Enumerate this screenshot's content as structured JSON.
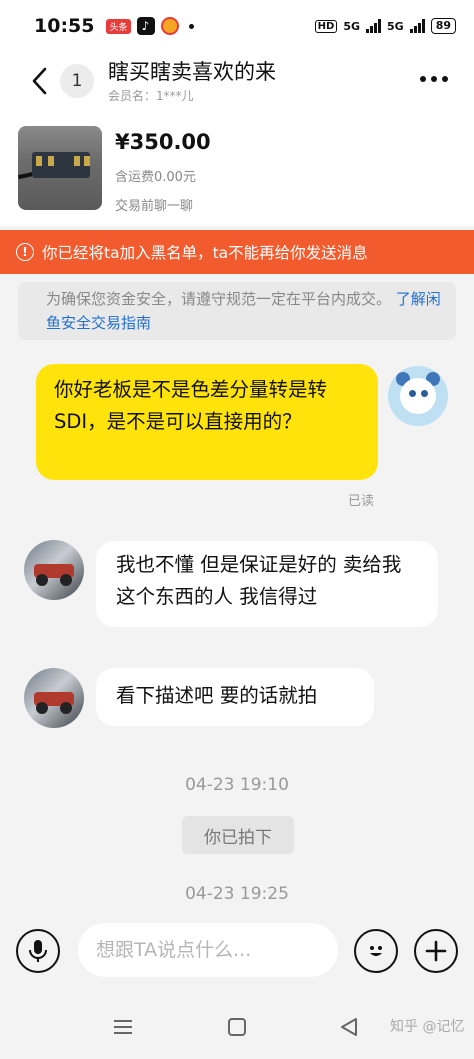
{
  "status_bar": {
    "time": "10:55",
    "app_badge": "头条",
    "hd_label": "HD",
    "net1": "5G",
    "net2": "5G",
    "battery": "89"
  },
  "header": {
    "unread_count": "1",
    "title": "瞎买瞎卖喜欢的来",
    "member_name": "会员名：1***儿"
  },
  "product": {
    "price": "¥350.00",
    "shipping": "含运费0.00元",
    "hint": "交易前聊一聊"
  },
  "banner": {
    "text": "你已经将ta加入黑名单，ta不能再给你发送消息",
    "icon": "!"
  },
  "safety_notice": {
    "text": "为确保您资金安全，请遵守规范一定在平台内成交。",
    "link": "了解闲鱼安全交易指南"
  },
  "messages": [
    {
      "side": "right",
      "text": "你好老板是不是色差分量转是转SDI，是不是可以直接用的？"
    },
    {
      "side": "left",
      "text": "我也不懂 但是保证是好的 卖给我这个东西的人 我信得过"
    },
    {
      "side": "left",
      "text": "看下描述吧 要的话就拍"
    }
  ],
  "read_status": "已读",
  "timestamps": [
    "04-23 19:10",
    "04-23 19:25"
  ],
  "system_message": "你已拍下",
  "input": {
    "placeholder": "想跟TA说点什么..."
  },
  "watermark": "知乎 @记忆",
  "icons": {
    "back": "chevron-left-icon",
    "more": "more-icon",
    "voice": "microphone-icon",
    "emoji": "emoji-icon",
    "plus": "plus-icon",
    "warning": "warning-icon"
  },
  "colors": {
    "own_bubble": "#ffe30a",
    "banner": "#f25b2e",
    "link": "#1f6fd1"
  }
}
